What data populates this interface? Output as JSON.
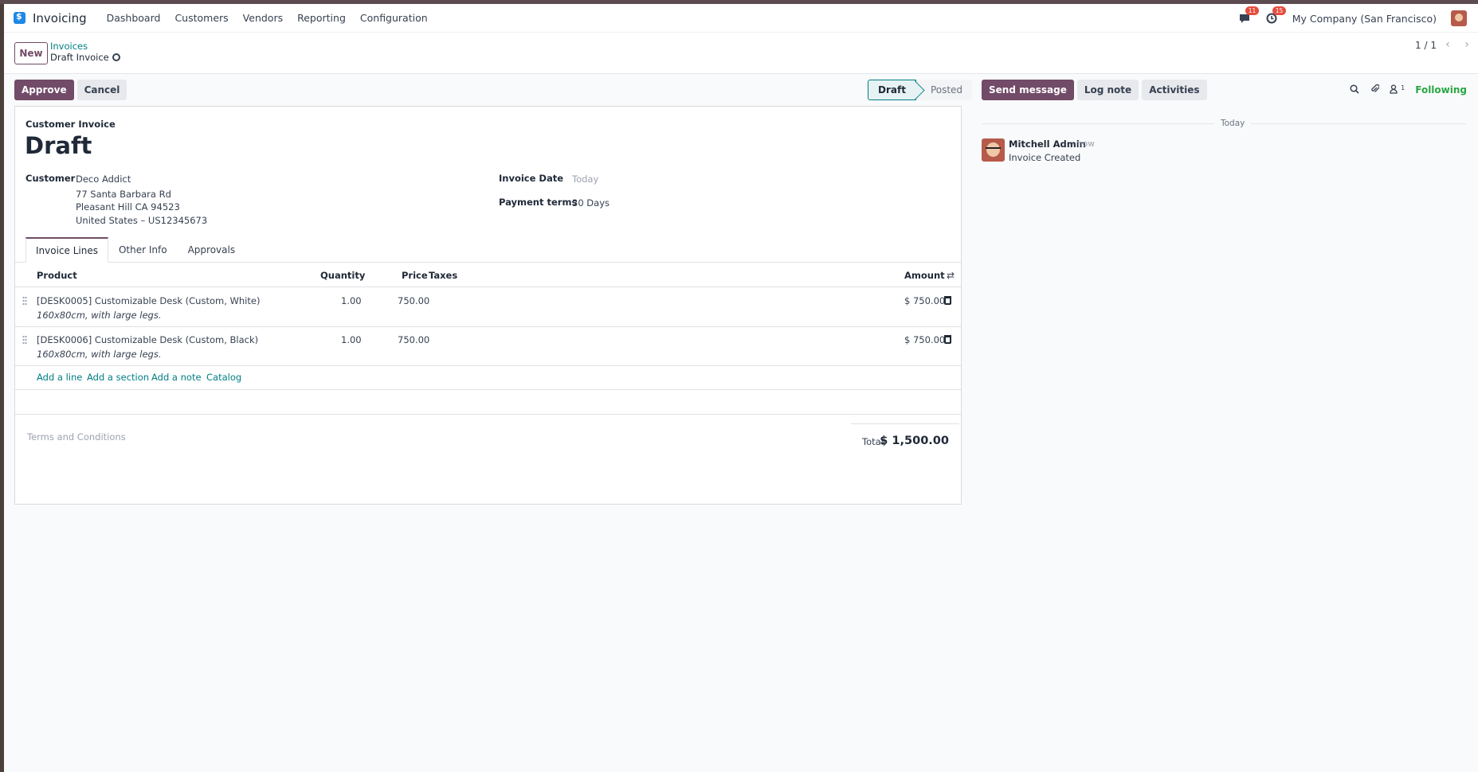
{
  "navbar": {
    "app_name": "Invoicing",
    "menu": [
      "Dashboard",
      "Customers",
      "Vendors",
      "Reporting",
      "Configuration"
    ],
    "messages_badge": "11",
    "activities_badge": "15",
    "company": "My Company (San Francisco)"
  },
  "control": {
    "new_label": "New",
    "breadcrumb_parent": "Invoices",
    "breadcrumb_current": "Draft Invoice",
    "pager": "1 / 1"
  },
  "actions": {
    "approve": "Approve",
    "cancel": "Cancel"
  },
  "statusbar": {
    "active": "Draft",
    "next": "Posted"
  },
  "invoice": {
    "move_type": "Customer Invoice",
    "name": "Draft",
    "customer_label": "Customer",
    "customer_name": "Deco Addict",
    "address_line1": "77 Santa Barbara Rd",
    "address_line2": "Pleasant Hill CA 94523",
    "address_line3": "United States – US12345673",
    "invoice_date_label": "Invoice Date",
    "invoice_date_placeholder": "Today",
    "payment_terms_label": "Payment terms",
    "payment_terms": "30 Days"
  },
  "tabs": [
    "Invoice Lines",
    "Other Info",
    "Approvals"
  ],
  "lines": {
    "headers": {
      "product": "Product",
      "quantity": "Quantity",
      "price": "Price",
      "taxes": "Taxes",
      "amount": "Amount"
    },
    "rows": [
      {
        "product": "[DESK0005] Customizable Desk (Custom, White)",
        "description": "160x80cm, with large legs.",
        "quantity": "1.00",
        "price": "750.00",
        "amount": "$ 750.00"
      },
      {
        "product": "[DESK0006] Customizable Desk (Custom, Black)",
        "description": "160x80cm, with large legs.",
        "quantity": "1.00",
        "price": "750.00",
        "amount": "$ 750.00"
      }
    ],
    "add_links": [
      "Add a line",
      "Add a section",
      "Add a note",
      "Catalog"
    ]
  },
  "footer": {
    "terms_placeholder": "Terms and Conditions",
    "total_label": "Total:",
    "total_value": "$ 1,500.00"
  },
  "chatter": {
    "send_message": "Send message",
    "log_note": "Log note",
    "activities": "Activities",
    "followers_count": "1",
    "following": "Following",
    "date_separator": "Today",
    "message": {
      "author": "Mitchell Admin",
      "time": "- now",
      "body": "Invoice Created"
    }
  },
  "colors": {
    "brand": "#714b67",
    "link": "#017e84",
    "following": "#28a745",
    "badge": "#e74c3c"
  }
}
